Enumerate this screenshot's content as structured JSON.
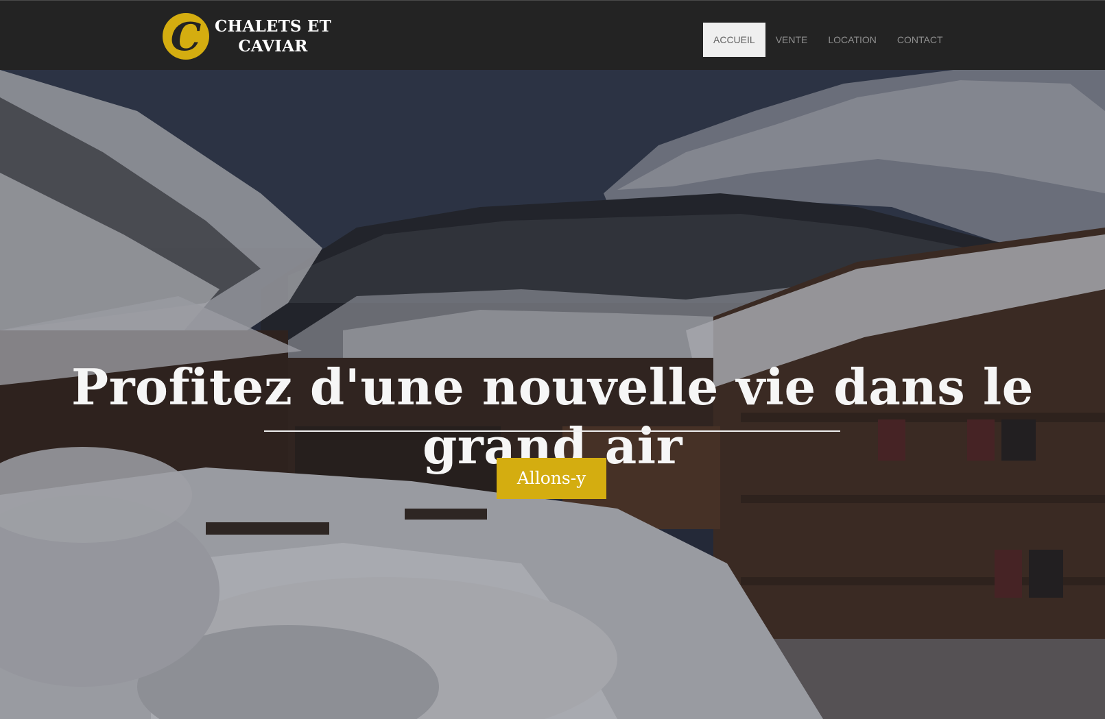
{
  "brand": {
    "logo_letter": "C",
    "name_line1": "CHALETS ET",
    "name_line2": "CAVIAR",
    "accent_color": "#d4ad10"
  },
  "nav": {
    "items": [
      {
        "label": "ACCUEIL",
        "active": true
      },
      {
        "label": "VENTE",
        "active": false
      },
      {
        "label": "LOCATION",
        "active": false
      },
      {
        "label": "CONTACT",
        "active": false
      }
    ]
  },
  "hero": {
    "title": "Profitez d'une nouvelle vie dans le grand air",
    "button_label": "Allons-y",
    "background": "snowy mountain village with wooden chalets"
  }
}
